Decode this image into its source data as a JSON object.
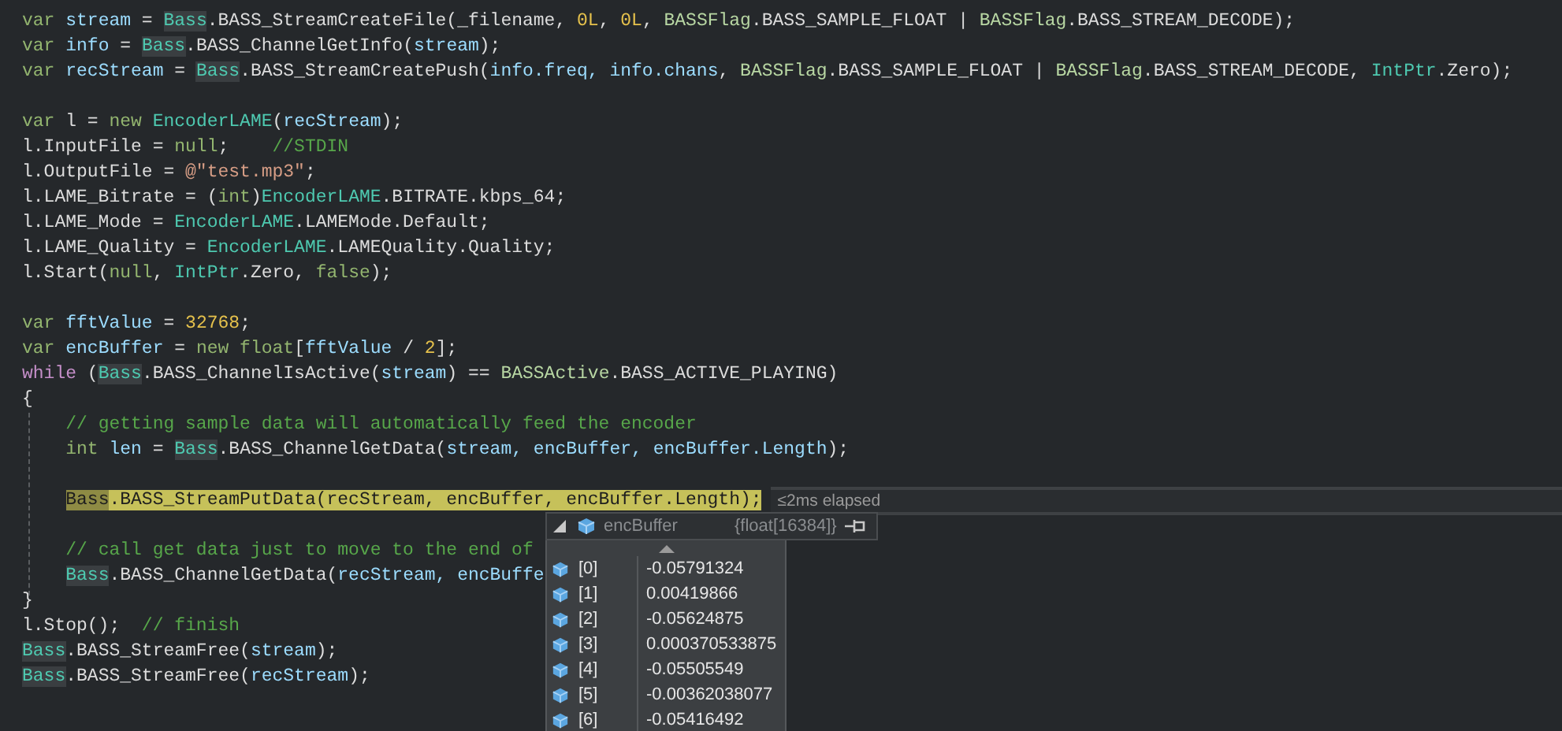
{
  "editor": {
    "lines": [
      {
        "tokens": [
          {
            "text": "var ",
            "kind": "kw"
          },
          {
            "text": "stream",
            "kind": "id"
          },
          {
            "text": " = ",
            "kind": "plain"
          },
          {
            "text": "Bass",
            "kind": "ref"
          },
          {
            "text": ".BASS_StreamCreateFile(_filename, ",
            "kind": "plain"
          },
          {
            "text": "0L",
            "kind": "num"
          },
          {
            "text": ", ",
            "kind": "plain"
          },
          {
            "text": "0L",
            "kind": "num"
          },
          {
            "text": ", ",
            "kind": "plain"
          },
          {
            "text": "BASSFlag",
            "kind": "enum"
          },
          {
            "text": ".BASS_SAMPLE_FLOAT | ",
            "kind": "plain"
          },
          {
            "text": "BASSFlag",
            "kind": "enum"
          },
          {
            "text": ".BASS_STREAM_DECODE);",
            "kind": "plain"
          }
        ]
      },
      {
        "tokens": [
          {
            "text": "var ",
            "kind": "kw"
          },
          {
            "text": "info",
            "kind": "id"
          },
          {
            "text": " = ",
            "kind": "plain"
          },
          {
            "text": "Bass",
            "kind": "ref"
          },
          {
            "text": ".BASS_ChannelGetInfo(",
            "kind": "plain"
          },
          {
            "text": "stream",
            "kind": "id"
          },
          {
            "text": ");",
            "kind": "plain"
          }
        ]
      },
      {
        "tokens": [
          {
            "text": "var ",
            "kind": "kw"
          },
          {
            "text": "recStream",
            "kind": "id"
          },
          {
            "text": " = ",
            "kind": "plain"
          },
          {
            "text": "Bass",
            "kind": "ref"
          },
          {
            "text": ".BASS_StreamCreatePush(",
            "kind": "plain"
          },
          {
            "text": "info.freq, info.chans",
            "kind": "id"
          },
          {
            "text": ", ",
            "kind": "plain"
          },
          {
            "text": "BASSFlag",
            "kind": "enum"
          },
          {
            "text": ".BASS_SAMPLE_FLOAT | ",
            "kind": "plain"
          },
          {
            "text": "BASSFlag",
            "kind": "enum"
          },
          {
            "text": ".BASS_STREAM_DECODE, ",
            "kind": "plain"
          },
          {
            "text": "IntPtr",
            "kind": "type"
          },
          {
            "text": ".Zero);",
            "kind": "plain"
          }
        ]
      },
      {
        "blank_before": true,
        "tokens": [
          {
            "text": "var",
            "kind": "kw"
          },
          {
            "text": " l = ",
            "kind": "plain"
          },
          {
            "text": "new ",
            "kind": "kw"
          },
          {
            "text": "EncoderLAME",
            "kind": "type"
          },
          {
            "text": "(",
            "kind": "plain"
          },
          {
            "text": "recStream",
            "kind": "id"
          },
          {
            "text": ");",
            "kind": "plain"
          }
        ]
      },
      {
        "tokens": [
          {
            "text": "l.InputFile = ",
            "kind": "plain"
          },
          {
            "text": "null",
            "kind": "kw"
          },
          {
            "text": ";    ",
            "kind": "plain"
          },
          {
            "text": "//STDIN",
            "kind": "comment"
          }
        ]
      },
      {
        "tokens": [
          {
            "text": "l.OutputFile = ",
            "kind": "plain"
          },
          {
            "text": "@\"test.mp3\"",
            "kind": "str"
          },
          {
            "text": ";",
            "kind": "plain"
          }
        ]
      },
      {
        "tokens": [
          {
            "text": "l.LAME_Bitrate = (",
            "kind": "plain"
          },
          {
            "text": "int",
            "kind": "kw"
          },
          {
            "text": ")",
            "kind": "plain"
          },
          {
            "text": "EncoderLAME",
            "kind": "type"
          },
          {
            "text": ".BITRATE.kbps_64;",
            "kind": "plain"
          }
        ]
      },
      {
        "tokens": [
          {
            "text": "l.LAME_Mode = ",
            "kind": "plain"
          },
          {
            "text": "EncoderLAME",
            "kind": "type"
          },
          {
            "text": ".LAMEMode.Default;",
            "kind": "plain"
          }
        ]
      },
      {
        "tokens": [
          {
            "text": "l.LAME_Quality = ",
            "kind": "plain"
          },
          {
            "text": "EncoderLAME",
            "kind": "type"
          },
          {
            "text": ".LAMEQuality.Quality;",
            "kind": "plain"
          }
        ]
      },
      {
        "tokens": [
          {
            "text": "l.Start(",
            "kind": "plain"
          },
          {
            "text": "null",
            "kind": "kw"
          },
          {
            "text": ", ",
            "kind": "plain"
          },
          {
            "text": "IntPtr",
            "kind": "type"
          },
          {
            "text": ".Zero, ",
            "kind": "plain"
          },
          {
            "text": "false",
            "kind": "kw"
          },
          {
            "text": ");",
            "kind": "plain"
          }
        ]
      },
      {
        "blank_before": true,
        "tokens": [
          {
            "text": "var ",
            "kind": "kw"
          },
          {
            "text": "fftValue",
            "kind": "id"
          },
          {
            "text": " = ",
            "kind": "plain"
          },
          {
            "text": "32768",
            "kind": "num"
          },
          {
            "text": ";",
            "kind": "plain"
          }
        ]
      },
      {
        "tokens": [
          {
            "text": "var ",
            "kind": "kw"
          },
          {
            "text": "encBuffer",
            "kind": "id"
          },
          {
            "text": " = ",
            "kind": "plain"
          },
          {
            "text": "new float",
            "kind": "kw"
          },
          {
            "text": "[",
            "kind": "plain"
          },
          {
            "text": "fftValue",
            "kind": "id"
          },
          {
            "text": " / ",
            "kind": "plain"
          },
          {
            "text": "2",
            "kind": "num"
          },
          {
            "text": "];",
            "kind": "plain"
          }
        ]
      },
      {
        "tokens": [
          {
            "text": "while",
            "kind": "ctrl"
          },
          {
            "text": " (",
            "kind": "plain"
          },
          {
            "text": "Bass",
            "kind": "ref"
          },
          {
            "text": ".BASS_ChannelIsActive(",
            "kind": "plain"
          },
          {
            "text": "stream",
            "kind": "id"
          },
          {
            "text": ") == ",
            "kind": "plain"
          },
          {
            "text": "BASSActive",
            "kind": "enum"
          },
          {
            "text": ".BASS_ACTIVE_PLAYING)",
            "kind": "plain"
          }
        ]
      },
      {
        "tokens": [
          {
            "text": "{",
            "kind": "plain"
          }
        ]
      },
      {
        "tokens": [
          {
            "text": "    // getting sample data will automatically feed the encoder",
            "kind": "comment"
          }
        ]
      },
      {
        "tokens": [
          {
            "text": "    int ",
            "kind": "kw"
          },
          {
            "text": "len",
            "kind": "id"
          },
          {
            "text": " = ",
            "kind": "plain"
          },
          {
            "text": "Bass",
            "kind": "ref"
          },
          {
            "text": ".BASS_ChannelGetData(",
            "kind": "plain"
          },
          {
            "text": "stream, encBuffer, encBuffer.Length",
            "kind": "id"
          },
          {
            "text": ");",
            "kind": "plain"
          }
        ]
      },
      {
        "blank_before": true,
        "current": true,
        "note": "≤2ms elapsed",
        "tokens": [
          {
            "text": "    Bass",
            "kind": "ref"
          },
          {
            "text": ".BASS_StreamPutData(recStream, encBuffer, encBuffer.Length);",
            "kind": "plain"
          }
        ]
      },
      {
        "blank_before": true,
        "tokens": [
          {
            "text": "    // call get data just to move to the end of",
            "kind": "comment"
          }
        ]
      },
      {
        "tokens": [
          {
            "text": "    Bass",
            "kind": "ref"
          },
          {
            "text": ".BASS_ChannelGetData(",
            "kind": "plain"
          },
          {
            "text": "recStream, encBuffe",
            "kind": "id"
          }
        ]
      },
      {
        "tokens": [
          {
            "text": "}",
            "kind": "plain"
          }
        ]
      },
      {
        "tokens": [
          {
            "text": "l.Stop();  ",
            "kind": "plain"
          },
          {
            "text": "// finish",
            "kind": "comment"
          }
        ]
      },
      {
        "tokens": [
          {
            "text": "Bass",
            "kind": "ref"
          },
          {
            "text": ".BASS_StreamFree(",
            "kind": "plain"
          },
          {
            "text": "stream",
            "kind": "id"
          },
          {
            "text": ");",
            "kind": "plain"
          }
        ]
      },
      {
        "tokens": [
          {
            "text": "Bass",
            "kind": "ref"
          },
          {
            "text": ".BASS_StreamFree(",
            "kind": "plain"
          },
          {
            "text": "recStream",
            "kind": "id"
          },
          {
            "text": ");",
            "kind": "plain"
          }
        ]
      }
    ]
  },
  "datatip": {
    "name": "encBuffer",
    "value": "{float[16384]}",
    "expanded": true,
    "items": [
      {
        "index": "[0]",
        "value": "-0.05791324"
      },
      {
        "index": "[1]",
        "value": "0.00419866"
      },
      {
        "index": "[2]",
        "value": "-0.05624875"
      },
      {
        "index": "[3]",
        "value": "0.000370533875"
      },
      {
        "index": "[4]",
        "value": "-0.05505549"
      },
      {
        "index": "[5]",
        "value": "-0.00362038077"
      },
      {
        "index": "[6]",
        "value": "-0.05416492"
      }
    ]
  }
}
